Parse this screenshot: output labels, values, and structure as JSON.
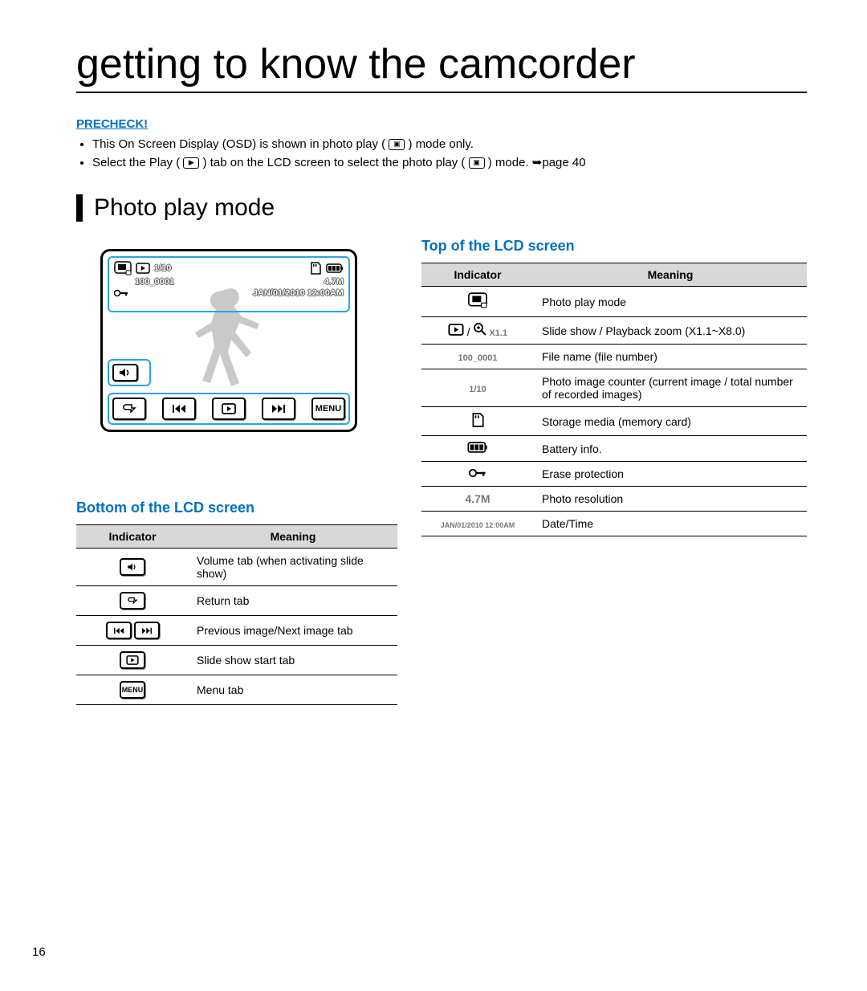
{
  "title": "getting to know the camcorder",
  "precheck": {
    "label": "PRECHECK!",
    "items": [
      "This On Screen Display (OSD) is shown in photo play ( ▣ ) mode only.",
      "Select the Play ( ▶ ) tab on the LCD screen to select the photo play ( ▣ ) mode. ➥page 40"
    ]
  },
  "section_heading": "Photo play mode",
  "osd": {
    "photo_counter": "1/10",
    "file_name": "100_0001",
    "resolution": "4.7M",
    "datetime": "JAN/01/2010 12:00AM",
    "menu_label": "MENU"
  },
  "top_table": {
    "heading": "Top of the LCD screen",
    "cols": [
      "Indicator",
      "Meaning"
    ],
    "rows": [
      {
        "icon": "photo-play-mode-icon",
        "label": "",
        "meaning": "Photo play mode"
      },
      {
        "icon": "slideshow-zoom-icon",
        "label": " /  X1.1",
        "meaning": "Slide show / Playback zoom (X1.1~X8.0)"
      },
      {
        "icon": "",
        "label": "100_0001",
        "meaning": "File name (file number)"
      },
      {
        "icon": "",
        "label": "1/10",
        "meaning": "Photo image counter (current image / total number of recorded images)"
      },
      {
        "icon": "memory-card-icon",
        "label": "",
        "meaning": "Storage media (memory card)"
      },
      {
        "icon": "battery-icon",
        "label": "",
        "meaning": "Battery info."
      },
      {
        "icon": "key-icon",
        "label": "",
        "meaning": "Erase protection"
      },
      {
        "icon": "",
        "label": "4.7M",
        "meaning": "Photo resolution"
      },
      {
        "icon": "",
        "label": "JAN/01/2010 12:00AM",
        "meaning": "Date/Time"
      }
    ]
  },
  "bottom_table": {
    "heading": "Bottom of the LCD screen",
    "cols": [
      "Indicator",
      "Meaning"
    ],
    "rows": [
      {
        "icon": "volume-icon",
        "meaning": "Volume tab (when activating slide show)"
      },
      {
        "icon": "return-icon",
        "meaning": "Return tab"
      },
      {
        "icon": "prev-next-icon",
        "meaning": "Previous image/Next image tab"
      },
      {
        "icon": "slideshow-start-icon",
        "meaning": "Slide show start tab"
      },
      {
        "icon": "menu-icon",
        "label": "MENU",
        "meaning": "Menu tab"
      }
    ]
  },
  "page_number": "16"
}
